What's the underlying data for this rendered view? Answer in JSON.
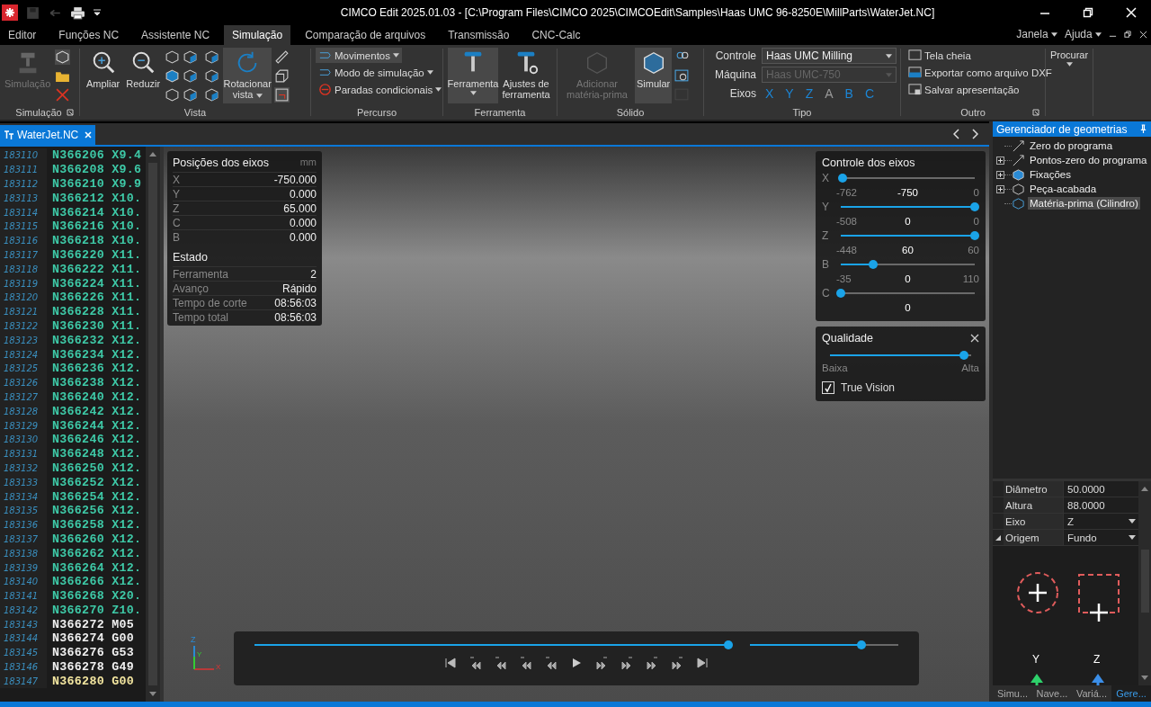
{
  "window": {
    "title": "CIMCO Edit 2025.01.03 - [C:\\Program Files\\CIMCO 2025\\CIMCOEdit\\Samples\\Haas UMC 96-8250E\\MillParts\\WaterJet.NC]"
  },
  "menu_tabs": [
    {
      "label": "Editor",
      "selected": false
    },
    {
      "label": "Funções NC",
      "selected": false
    },
    {
      "label": "Assistente NC",
      "selected": false
    },
    {
      "label": "Simulação",
      "selected": true
    },
    {
      "label": "Comparação de arquivos",
      "selected": false
    },
    {
      "label": "Transmissão",
      "selected": false
    },
    {
      "label": "CNC-Calc",
      "selected": false
    }
  ],
  "window_menus": [
    "Janela",
    "Ajuda"
  ],
  "ribbon": {
    "simulacao": {
      "label": "Simulação",
      "button": {
        "label": "Simulação",
        "disabled": true
      }
    },
    "vista": {
      "label": "Vista",
      "buttons": [
        {
          "label": "Ampliar",
          "selected": false
        },
        {
          "label": "Reduzir",
          "selected": false
        },
        {
          "label": "Rotacionar vista",
          "selected": true
        }
      ]
    },
    "percurso": {
      "label": "Percurso",
      "items": [
        {
          "label": "Movimentos",
          "selected": true
        },
        {
          "label": "Modo de simulação",
          "selected": false
        },
        {
          "label": "Paradas condicionais",
          "selected": false
        }
      ]
    },
    "ferramenta": {
      "label": "Ferramenta",
      "buttons": [
        {
          "label": "Ferramenta",
          "selected": true
        },
        {
          "label": "Ajustes de ferramenta",
          "selected": false
        }
      ]
    },
    "solido": {
      "label": "Sólido",
      "buttons": [
        {
          "label": "Adicionar matéria-prima",
          "disabled": true,
          "selected": false
        },
        {
          "label": "Simular",
          "disabled": false,
          "selected": true
        }
      ]
    },
    "tipo": {
      "label": "Tipo",
      "fields": [
        {
          "label": "Controle",
          "value": "Haas UMC Milling",
          "disabled": false
        },
        {
          "label": "Máquina",
          "value": "Haas UMC-750",
          "disabled": true
        }
      ],
      "axes_label": "Eixos",
      "axes": [
        {
          "label": "X",
          "on": true
        },
        {
          "label": "Y",
          "on": true
        },
        {
          "label": "Z",
          "on": true
        },
        {
          "label": "A",
          "on": false
        },
        {
          "label": "B",
          "on": true
        },
        {
          "label": "C",
          "on": true
        }
      ]
    },
    "outro": {
      "label": "Outro",
      "items": [
        "Tela cheia",
        "Exportar como arquivo DXF",
        "Salvar apresentação"
      ]
    },
    "procurar": {
      "label": "Procurar"
    }
  },
  "doc_tab": {
    "label": "WaterJet.NC",
    "selected": true
  },
  "code_lines": [
    {
      "number": "183110",
      "code": "N366206 X9.4",
      "kind": "executed"
    },
    {
      "number": "183111",
      "code": "N366208 X9.6",
      "kind": "executed"
    },
    {
      "number": "183112",
      "code": "N366210 X9.9",
      "kind": "executed"
    },
    {
      "number": "183113",
      "code": "N366212 X10.",
      "kind": "executed"
    },
    {
      "number": "183114",
      "code": "N366214 X10.",
      "kind": "executed"
    },
    {
      "number": "183115",
      "code": "N366216 X10.",
      "kind": "executed"
    },
    {
      "number": "183116",
      "code": "N366218 X10.",
      "kind": "executed"
    },
    {
      "number": "183117",
      "code": "N366220 X11.",
      "kind": "executed"
    },
    {
      "number": "183118",
      "code": "N366222 X11.",
      "kind": "executed"
    },
    {
      "number": "183119",
      "code": "N366224 X11.",
      "kind": "executed"
    },
    {
      "number": "183120",
      "code": "N366226 X11.",
      "kind": "executed"
    },
    {
      "number": "183121",
      "code": "N366228 X11.",
      "kind": "executed"
    },
    {
      "number": "183122",
      "code": "N366230 X11.",
      "kind": "executed"
    },
    {
      "number": "183123",
      "code": "N366232 X12.",
      "kind": "executed"
    },
    {
      "number": "183124",
      "code": "N366234 X12.",
      "kind": "executed"
    },
    {
      "number": "183125",
      "code": "N366236 X12.",
      "kind": "executed"
    },
    {
      "number": "183126",
      "code": "N366238 X12.",
      "kind": "executed"
    },
    {
      "number": "183127",
      "code": "N366240 X12.",
      "kind": "executed"
    },
    {
      "number": "183128",
      "code": "N366242 X12.",
      "kind": "executed"
    },
    {
      "number": "183129",
      "code": "N366244 X12.",
      "kind": "executed"
    },
    {
      "number": "183130",
      "code": "N366246 X12.",
      "kind": "executed"
    },
    {
      "number": "183131",
      "code": "N366248 X12.",
      "kind": "executed"
    },
    {
      "number": "183132",
      "code": "N366250 X12.",
      "kind": "executed"
    },
    {
      "number": "183133",
      "code": "N366252 X12.",
      "kind": "executed"
    },
    {
      "number": "183134",
      "code": "N366254 X12.",
      "kind": "executed"
    },
    {
      "number": "183135",
      "code": "N366256 X12.",
      "kind": "executed"
    },
    {
      "number": "183136",
      "code": "N366258 X12.",
      "kind": "executed"
    },
    {
      "number": "183137",
      "code": "N366260 X12.",
      "kind": "executed"
    },
    {
      "number": "183138",
      "code": "N366262 X12.",
      "kind": "executed"
    },
    {
      "number": "183139",
      "code": "N366264 X12.",
      "kind": "executed"
    },
    {
      "number": "183140",
      "code": "N366266 X12.",
      "kind": "executed"
    },
    {
      "number": "183141",
      "code": "N366268 X20.",
      "kind": "executed"
    },
    {
      "number": "183142",
      "code": "N366270 Z10.",
      "kind": "executed"
    },
    {
      "number": "183143",
      "code": "N366272 M05",
      "kind": "pending"
    },
    {
      "number": "183144",
      "code": "N366274 G00",
      "kind": "pending"
    },
    {
      "number": "183145",
      "code": "N366276 G53",
      "kind": "pending"
    },
    {
      "number": "183146",
      "code": "N366278 G49",
      "kind": "pending"
    },
    {
      "number": "183147",
      "code": "N366280 G00",
      "kind": "current"
    }
  ],
  "axis_positions": {
    "title": "Posições dos eixos",
    "unit": "mm",
    "rows": [
      {
        "axis": "X",
        "value": "-750.000"
      },
      {
        "axis": "Y",
        "value": "0.000"
      },
      {
        "axis": "Z",
        "value": "65.000"
      },
      {
        "axis": "C",
        "value": "0.000"
      },
      {
        "axis": "B",
        "value": "0.000"
      }
    ]
  },
  "status": {
    "title": "Estado",
    "rows": [
      {
        "label": "Ferramenta",
        "value": "2"
      },
      {
        "label": "Avanço",
        "value": "Rápido"
      },
      {
        "label": "Tempo de corte",
        "value": "08:56:03"
      },
      {
        "label": "Tempo total",
        "value": "08:56:03"
      }
    ]
  },
  "axis_triad": {
    "labels": [
      "Z",
      "Y",
      "X"
    ]
  },
  "axis_control": {
    "title": "Controle dos eixos",
    "axes": [
      {
        "axis": "X",
        "level": 0.016,
        "min": "-762",
        "value": "-750",
        "max": "0"
      },
      {
        "axis": "Y",
        "level": 1,
        "min": "-508",
        "value": "0",
        "max": "0"
      },
      {
        "axis": "Z",
        "level": 1,
        "min": "-448",
        "value": "60",
        "max": "60"
      },
      {
        "axis": "B",
        "level": 0.24,
        "min": "-35",
        "value": "0",
        "max": "110"
      },
      {
        "axis": "C",
        "level": 0,
        "value": "0"
      }
    ]
  },
  "quality": {
    "title": "Qualidade",
    "level": 0.95,
    "low": "Baixa",
    "high": "Alta",
    "true_vision": {
      "label": "True Vision",
      "checked": true
    }
  },
  "playback": {
    "timeline": {
      "level": 1
    },
    "speed": {
      "level": 0.75
    }
  },
  "geometry_manager": {
    "title": "Gerenciador de geometrias",
    "items": [
      {
        "label": "Zero do programa",
        "kind": "leaf",
        "selected": false
      },
      {
        "label": "Pontos-zero do programa",
        "kind": "group",
        "expanded": false,
        "selected": false
      },
      {
        "label": "Fixações",
        "kind": "group",
        "expanded": false,
        "selected": false
      },
      {
        "label": "Peça-acabada",
        "kind": "group",
        "expanded": false,
        "selected": false
      },
      {
        "label": "Matéria-prima (Cilindro)",
        "kind": "leaf",
        "selected": true
      }
    ],
    "properties": [
      {
        "label": "Diâmetro",
        "value": "50.0000",
        "kind": "text"
      },
      {
        "label": "Altura",
        "value": "88.0000",
        "kind": "text"
      },
      {
        "label": "Eixo",
        "value": "Z",
        "kind": "dropdown"
      },
      {
        "label": "Origem",
        "value": "Fundo",
        "kind": "dropdown"
      }
    ],
    "origin_axes": [
      "Y",
      "Z"
    ],
    "bottom_tabs": [
      {
        "label": "Simu...",
        "selected": false
      },
      {
        "label": "Nave...",
        "selected": false
      },
      {
        "label": "Variá...",
        "selected": false
      },
      {
        "label": "Gere...",
        "selected": true
      }
    ]
  }
}
